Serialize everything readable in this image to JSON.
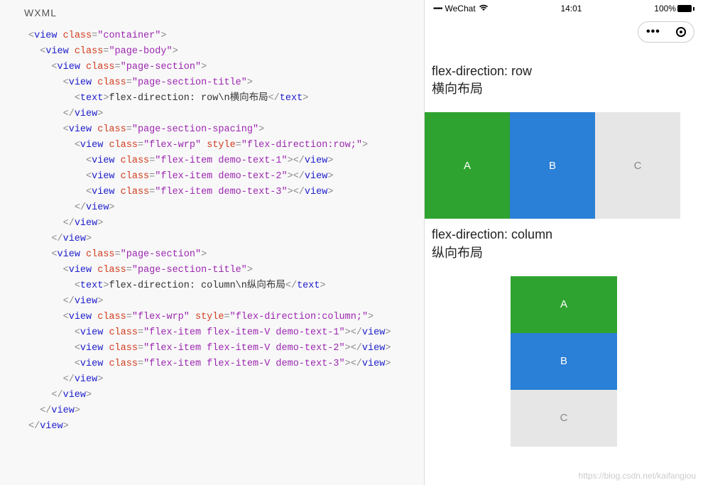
{
  "editor": {
    "tab": "WXML",
    "code": [
      {
        "indent": 0,
        "raw": [
          {
            "t": "punct",
            "v": "<"
          },
          {
            "t": "tag",
            "v": "view"
          },
          {
            "t": "text",
            "v": " "
          },
          {
            "t": "attr",
            "v": "class"
          },
          {
            "t": "punct",
            "v": "="
          },
          {
            "t": "val",
            "v": "\"container\""
          },
          {
            "t": "punct",
            "v": ">"
          }
        ]
      },
      {
        "indent": 1,
        "raw": [
          {
            "t": "punct",
            "v": "<"
          },
          {
            "t": "tag",
            "v": "view"
          },
          {
            "t": "text",
            "v": " "
          },
          {
            "t": "attr",
            "v": "class"
          },
          {
            "t": "punct",
            "v": "="
          },
          {
            "t": "val",
            "v": "\"page-body\""
          },
          {
            "t": "punct",
            "v": ">"
          }
        ]
      },
      {
        "indent": 2,
        "raw": [
          {
            "t": "punct",
            "v": "<"
          },
          {
            "t": "tag",
            "v": "view"
          },
          {
            "t": "text",
            "v": " "
          },
          {
            "t": "attr",
            "v": "class"
          },
          {
            "t": "punct",
            "v": "="
          },
          {
            "t": "val",
            "v": "\"page-section\""
          },
          {
            "t": "punct",
            "v": ">"
          }
        ]
      },
      {
        "indent": 3,
        "raw": [
          {
            "t": "punct",
            "v": "<"
          },
          {
            "t": "tag",
            "v": "view"
          },
          {
            "t": "text",
            "v": " "
          },
          {
            "t": "attr",
            "v": "class"
          },
          {
            "t": "punct",
            "v": "="
          },
          {
            "t": "val",
            "v": "\"page-section-title\""
          },
          {
            "t": "punct",
            "v": ">"
          }
        ]
      },
      {
        "indent": 4,
        "raw": [
          {
            "t": "punct",
            "v": "<"
          },
          {
            "t": "tag",
            "v": "text"
          },
          {
            "t": "punct",
            "v": ">"
          },
          {
            "t": "text",
            "v": "flex-direction: row\\n横向布局"
          },
          {
            "t": "punct",
            "v": "</"
          },
          {
            "t": "tag",
            "v": "text"
          },
          {
            "t": "punct",
            "v": ">"
          }
        ]
      },
      {
        "indent": 3,
        "raw": [
          {
            "t": "punct",
            "v": "</"
          },
          {
            "t": "tag",
            "v": "view"
          },
          {
            "t": "punct",
            "v": ">"
          }
        ]
      },
      {
        "indent": 3,
        "raw": [
          {
            "t": "punct",
            "v": "<"
          },
          {
            "t": "tag",
            "v": "view"
          },
          {
            "t": "text",
            "v": " "
          },
          {
            "t": "attr",
            "v": "class"
          },
          {
            "t": "punct",
            "v": "="
          },
          {
            "t": "val",
            "v": "\"page-section-spacing\""
          },
          {
            "t": "punct",
            "v": ">"
          }
        ]
      },
      {
        "indent": 4,
        "raw": [
          {
            "t": "punct",
            "v": "<"
          },
          {
            "t": "tag",
            "v": "view"
          },
          {
            "t": "text",
            "v": " "
          },
          {
            "t": "attr",
            "v": "class"
          },
          {
            "t": "punct",
            "v": "="
          },
          {
            "t": "val",
            "v": "\"flex-wrp\""
          },
          {
            "t": "text",
            "v": " "
          },
          {
            "t": "attr",
            "v": "style"
          },
          {
            "t": "punct",
            "v": "="
          },
          {
            "t": "val",
            "v": "\"flex-direction:row;\""
          },
          {
            "t": "punct",
            "v": ">"
          }
        ]
      },
      {
        "indent": 5,
        "raw": [
          {
            "t": "punct",
            "v": "<"
          },
          {
            "t": "tag",
            "v": "view"
          },
          {
            "t": "text",
            "v": " "
          },
          {
            "t": "attr",
            "v": "class"
          },
          {
            "t": "punct",
            "v": "="
          },
          {
            "t": "val",
            "v": "\"flex-item demo-text-1\""
          },
          {
            "t": "punct",
            "v": "></"
          },
          {
            "t": "tag",
            "v": "view"
          },
          {
            "t": "punct",
            "v": ">"
          }
        ]
      },
      {
        "indent": 5,
        "raw": [
          {
            "t": "punct",
            "v": "<"
          },
          {
            "t": "tag",
            "v": "view"
          },
          {
            "t": "text",
            "v": " "
          },
          {
            "t": "attr",
            "v": "class"
          },
          {
            "t": "punct",
            "v": "="
          },
          {
            "t": "val",
            "v": "\"flex-item demo-text-2\""
          },
          {
            "t": "punct",
            "v": "></"
          },
          {
            "t": "tag",
            "v": "view"
          },
          {
            "t": "punct",
            "v": ">"
          }
        ]
      },
      {
        "indent": 5,
        "raw": [
          {
            "t": "punct",
            "v": "<"
          },
          {
            "t": "tag",
            "v": "view"
          },
          {
            "t": "text",
            "v": " "
          },
          {
            "t": "attr",
            "v": "class"
          },
          {
            "t": "punct",
            "v": "="
          },
          {
            "t": "val",
            "v": "\"flex-item demo-text-3\""
          },
          {
            "t": "punct",
            "v": "></"
          },
          {
            "t": "tag",
            "v": "view"
          },
          {
            "t": "punct",
            "v": ">"
          }
        ]
      },
      {
        "indent": 4,
        "raw": [
          {
            "t": "punct",
            "v": "</"
          },
          {
            "t": "tag",
            "v": "view"
          },
          {
            "t": "punct",
            "v": ">"
          }
        ]
      },
      {
        "indent": 3,
        "raw": [
          {
            "t": "punct",
            "v": "</"
          },
          {
            "t": "tag",
            "v": "view"
          },
          {
            "t": "punct",
            "v": ">"
          }
        ]
      },
      {
        "indent": 2,
        "raw": [
          {
            "t": "punct",
            "v": "</"
          },
          {
            "t": "tag",
            "v": "view"
          },
          {
            "t": "punct",
            "v": ">"
          }
        ]
      },
      {
        "indent": 2,
        "raw": [
          {
            "t": "punct",
            "v": "<"
          },
          {
            "t": "tag",
            "v": "view"
          },
          {
            "t": "text",
            "v": " "
          },
          {
            "t": "attr",
            "v": "class"
          },
          {
            "t": "punct",
            "v": "="
          },
          {
            "t": "val",
            "v": "\"page-section\""
          },
          {
            "t": "punct",
            "v": ">"
          }
        ]
      },
      {
        "indent": 3,
        "raw": [
          {
            "t": "punct",
            "v": "<"
          },
          {
            "t": "tag",
            "v": "view"
          },
          {
            "t": "text",
            "v": " "
          },
          {
            "t": "attr",
            "v": "class"
          },
          {
            "t": "punct",
            "v": "="
          },
          {
            "t": "val",
            "v": "\"page-section-title\""
          },
          {
            "t": "punct",
            "v": ">"
          }
        ]
      },
      {
        "indent": 4,
        "raw": [
          {
            "t": "punct",
            "v": "<"
          },
          {
            "t": "tag",
            "v": "text"
          },
          {
            "t": "punct",
            "v": ">"
          },
          {
            "t": "text",
            "v": "flex-direction: column\\n纵向布局"
          },
          {
            "t": "punct",
            "v": "</"
          },
          {
            "t": "tag",
            "v": "text"
          },
          {
            "t": "punct",
            "v": ">"
          }
        ]
      },
      {
        "indent": 3,
        "raw": [
          {
            "t": "punct",
            "v": "</"
          },
          {
            "t": "tag",
            "v": "view"
          },
          {
            "t": "punct",
            "v": ">"
          }
        ]
      },
      {
        "indent": 3,
        "raw": [
          {
            "t": "punct",
            "v": "<"
          },
          {
            "t": "tag",
            "v": "view"
          },
          {
            "t": "text",
            "v": " "
          },
          {
            "t": "attr",
            "v": "class"
          },
          {
            "t": "punct",
            "v": "="
          },
          {
            "t": "val",
            "v": "\"flex-wrp\""
          },
          {
            "t": "text",
            "v": " "
          },
          {
            "t": "attr",
            "v": "style"
          },
          {
            "t": "punct",
            "v": "="
          },
          {
            "t": "val",
            "v": "\"flex-direction:column;\""
          },
          {
            "t": "punct",
            "v": ">"
          }
        ]
      },
      {
        "indent": 4,
        "raw": [
          {
            "t": "punct",
            "v": "<"
          },
          {
            "t": "tag",
            "v": "view"
          },
          {
            "t": "text",
            "v": " "
          },
          {
            "t": "attr",
            "v": "class"
          },
          {
            "t": "punct",
            "v": "="
          },
          {
            "t": "val",
            "v": "\"flex-item flex-item-V demo-text-1\""
          },
          {
            "t": "punct",
            "v": "></"
          },
          {
            "t": "tag",
            "v": "view"
          },
          {
            "t": "punct",
            "v": ">"
          }
        ]
      },
      {
        "indent": 4,
        "raw": [
          {
            "t": "punct",
            "v": "<"
          },
          {
            "t": "tag",
            "v": "view"
          },
          {
            "t": "text",
            "v": " "
          },
          {
            "t": "attr",
            "v": "class"
          },
          {
            "t": "punct",
            "v": "="
          },
          {
            "t": "val",
            "v": "\"flex-item flex-item-V demo-text-2\""
          },
          {
            "t": "punct",
            "v": "></"
          },
          {
            "t": "tag",
            "v": "view"
          },
          {
            "t": "punct",
            "v": ">"
          }
        ]
      },
      {
        "indent": 4,
        "raw": [
          {
            "t": "punct",
            "v": "<"
          },
          {
            "t": "tag",
            "v": "view"
          },
          {
            "t": "text",
            "v": " "
          },
          {
            "t": "attr",
            "v": "class"
          },
          {
            "t": "punct",
            "v": "="
          },
          {
            "t": "val",
            "v": "\"flex-item flex-item-V demo-text-3\""
          },
          {
            "t": "punct",
            "v": "></"
          },
          {
            "t": "tag",
            "v": "view"
          },
          {
            "t": "punct",
            "v": ">"
          }
        ]
      },
      {
        "indent": 3,
        "raw": [
          {
            "t": "punct",
            "v": "</"
          },
          {
            "t": "tag",
            "v": "view"
          },
          {
            "t": "punct",
            "v": ">"
          }
        ]
      },
      {
        "indent": 2,
        "raw": [
          {
            "t": "punct",
            "v": "</"
          },
          {
            "t": "tag",
            "v": "view"
          },
          {
            "t": "punct",
            "v": ">"
          }
        ]
      },
      {
        "indent": 1,
        "raw": [
          {
            "t": "punct",
            "v": "</"
          },
          {
            "t": "tag",
            "v": "view"
          },
          {
            "t": "punct",
            "v": ">"
          }
        ]
      },
      {
        "indent": 0,
        "raw": [
          {
            "t": "punct",
            "v": "</"
          },
          {
            "t": "tag",
            "v": "view"
          },
          {
            "t": "punct",
            "v": ">"
          }
        ]
      }
    ]
  },
  "simulator": {
    "statusbar": {
      "carrier": "WeChat",
      "signal_dots": "•••••",
      "time": "14:01",
      "battery_pct": "100%"
    },
    "section1": {
      "title_en": "flex-direction: row",
      "title_cn": "横向布局",
      "items": [
        "A",
        "B",
        "C"
      ]
    },
    "section2": {
      "title_en": "flex-direction: column",
      "title_cn": "纵向布局",
      "items": [
        "A",
        "B",
        "C"
      ]
    },
    "watermark": "https://blog.csdn.net/kaifangiou"
  }
}
